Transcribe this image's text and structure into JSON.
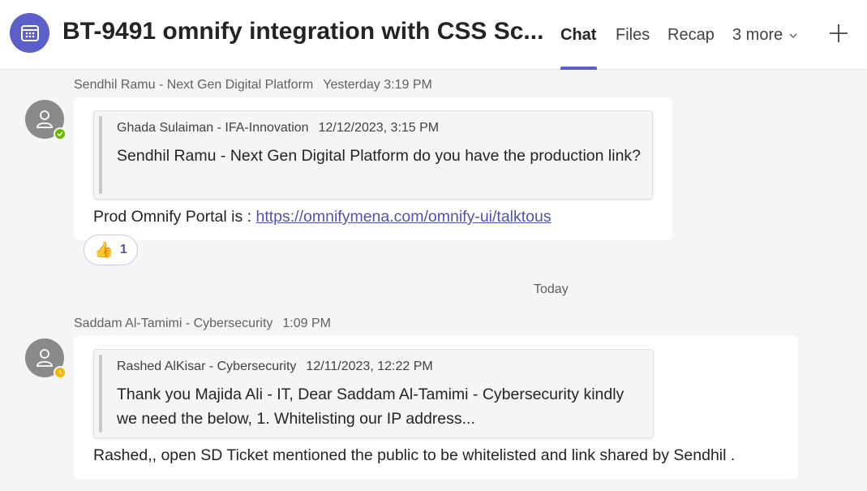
{
  "header": {
    "title": "BT-9491 omnify integration with CSS Sc...",
    "tabs": [
      {
        "label": "Chat"
      },
      {
        "label": "Files"
      },
      {
        "label": "Recap"
      }
    ],
    "more_label": "3 more"
  },
  "messages": [
    {
      "sender": "Sendhil Ramu - Next Gen Digital Platform",
      "time": "Yesterday 3:19 PM",
      "status": "available",
      "quote": {
        "author": "Ghada Sulaiman - IFA-Innovation",
        "time": "12/12/2023, 3:15 PM",
        "text": "Sendhil Ramu - Next Gen Digital Platform do you have the production link?"
      },
      "body_prefix": "Prod Omnify Portal is : ",
      "link": "https://omnifymena.com/omnify-ui/talktous",
      "reaction": {
        "emoji": "👍",
        "count": "1"
      }
    },
    {
      "sender": "Saddam Al-Tamimi - Cybersecurity",
      "time": "1:09 PM",
      "status": "away",
      "quote": {
        "author": "Rashed AlKisar - Cybersecurity",
        "time": "12/11/2023, 12:22 PM",
        "text": "Thank you Majida Ali - IT, Dear Saddam Al-Tamimi - Cybersecurity kindly we need the below, 1. Whitelisting our IP address..."
      },
      "body": "Rashed,, open SD Ticket mentioned the public to be whitelisted and link shared by Sendhil ."
    }
  ],
  "divider": "Today",
  "colors": {
    "accent": "#5b5fc7",
    "available": "#6bb700",
    "away": "#f8b500"
  }
}
